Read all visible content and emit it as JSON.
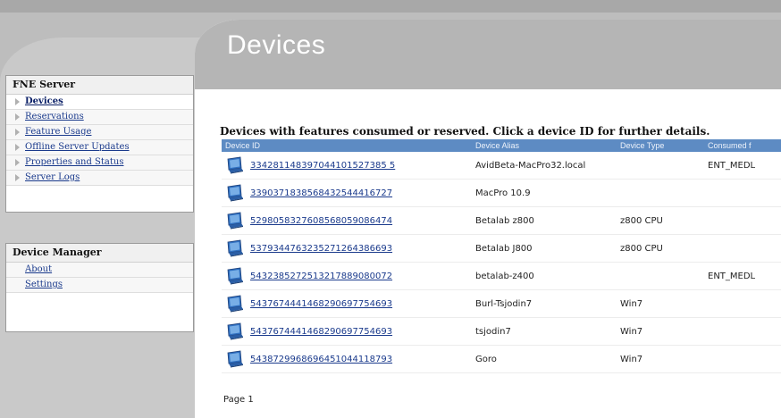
{
  "sidebar": {
    "fne": {
      "title": "FNE Server",
      "items": [
        {
          "label": "Devices"
        },
        {
          "label": "Reservations"
        },
        {
          "label": "Feature Usage"
        },
        {
          "label": "Offline Server Updates"
        },
        {
          "label": "Properties and Status"
        },
        {
          "label": "Server Logs"
        }
      ]
    },
    "device_manager": {
      "title": "Device Manager",
      "items": [
        {
          "label": "About"
        },
        {
          "label": "Settings"
        }
      ]
    }
  },
  "main": {
    "title": "Devices",
    "subtitle": "Devices with features consumed or reserved. Click a device ID for further details.",
    "table": {
      "columns": [
        "Device ID",
        "Device Alias",
        "Device Type",
        "Consumed f"
      ],
      "rows": [
        {
          "id": "334281148397044101527385 5",
          "alias": "AvidBeta-MacPro32.local",
          "type": "",
          "consumed": "ENT_MEDL"
        },
        {
          "id": "3390371838568432544416727",
          "alias": "MacPro 10.9",
          "type": "",
          "consumed": ""
        },
        {
          "id": "5298058327608568059086474",
          "alias": "Betalab z800",
          "type": "z800 CPU",
          "consumed": ""
        },
        {
          "id": "5379344763235271264386693",
          "alias": "Betalab J800",
          "type": "z800 CPU",
          "consumed": ""
        },
        {
          "id": "5432385272513217889080072",
          "alias": "betalab-z400",
          "type": "",
          "consumed": "ENT_MEDL"
        },
        {
          "id": "5437674441468290697754693",
          "alias": "Burl-Tsjodin7",
          "type": "Win7",
          "consumed": ""
        },
        {
          "id": "5437674441468290697754693",
          "alias": "tsjodin7",
          "type": "Win7",
          "consumed": ""
        },
        {
          "id": "5438729968696451044118793",
          "alias": "Goro",
          "type": "Win7",
          "consumed": ""
        }
      ]
    },
    "pagination": "Page 1"
  },
  "icons": {
    "device_icon": "monitor-icon",
    "nav_arrow": "triangle-right-icon"
  },
  "colors": {
    "header_gray": "#b5b5b5",
    "table_header_blue": "#5d8bc3",
    "link_blue": "#1a3a8c"
  }
}
